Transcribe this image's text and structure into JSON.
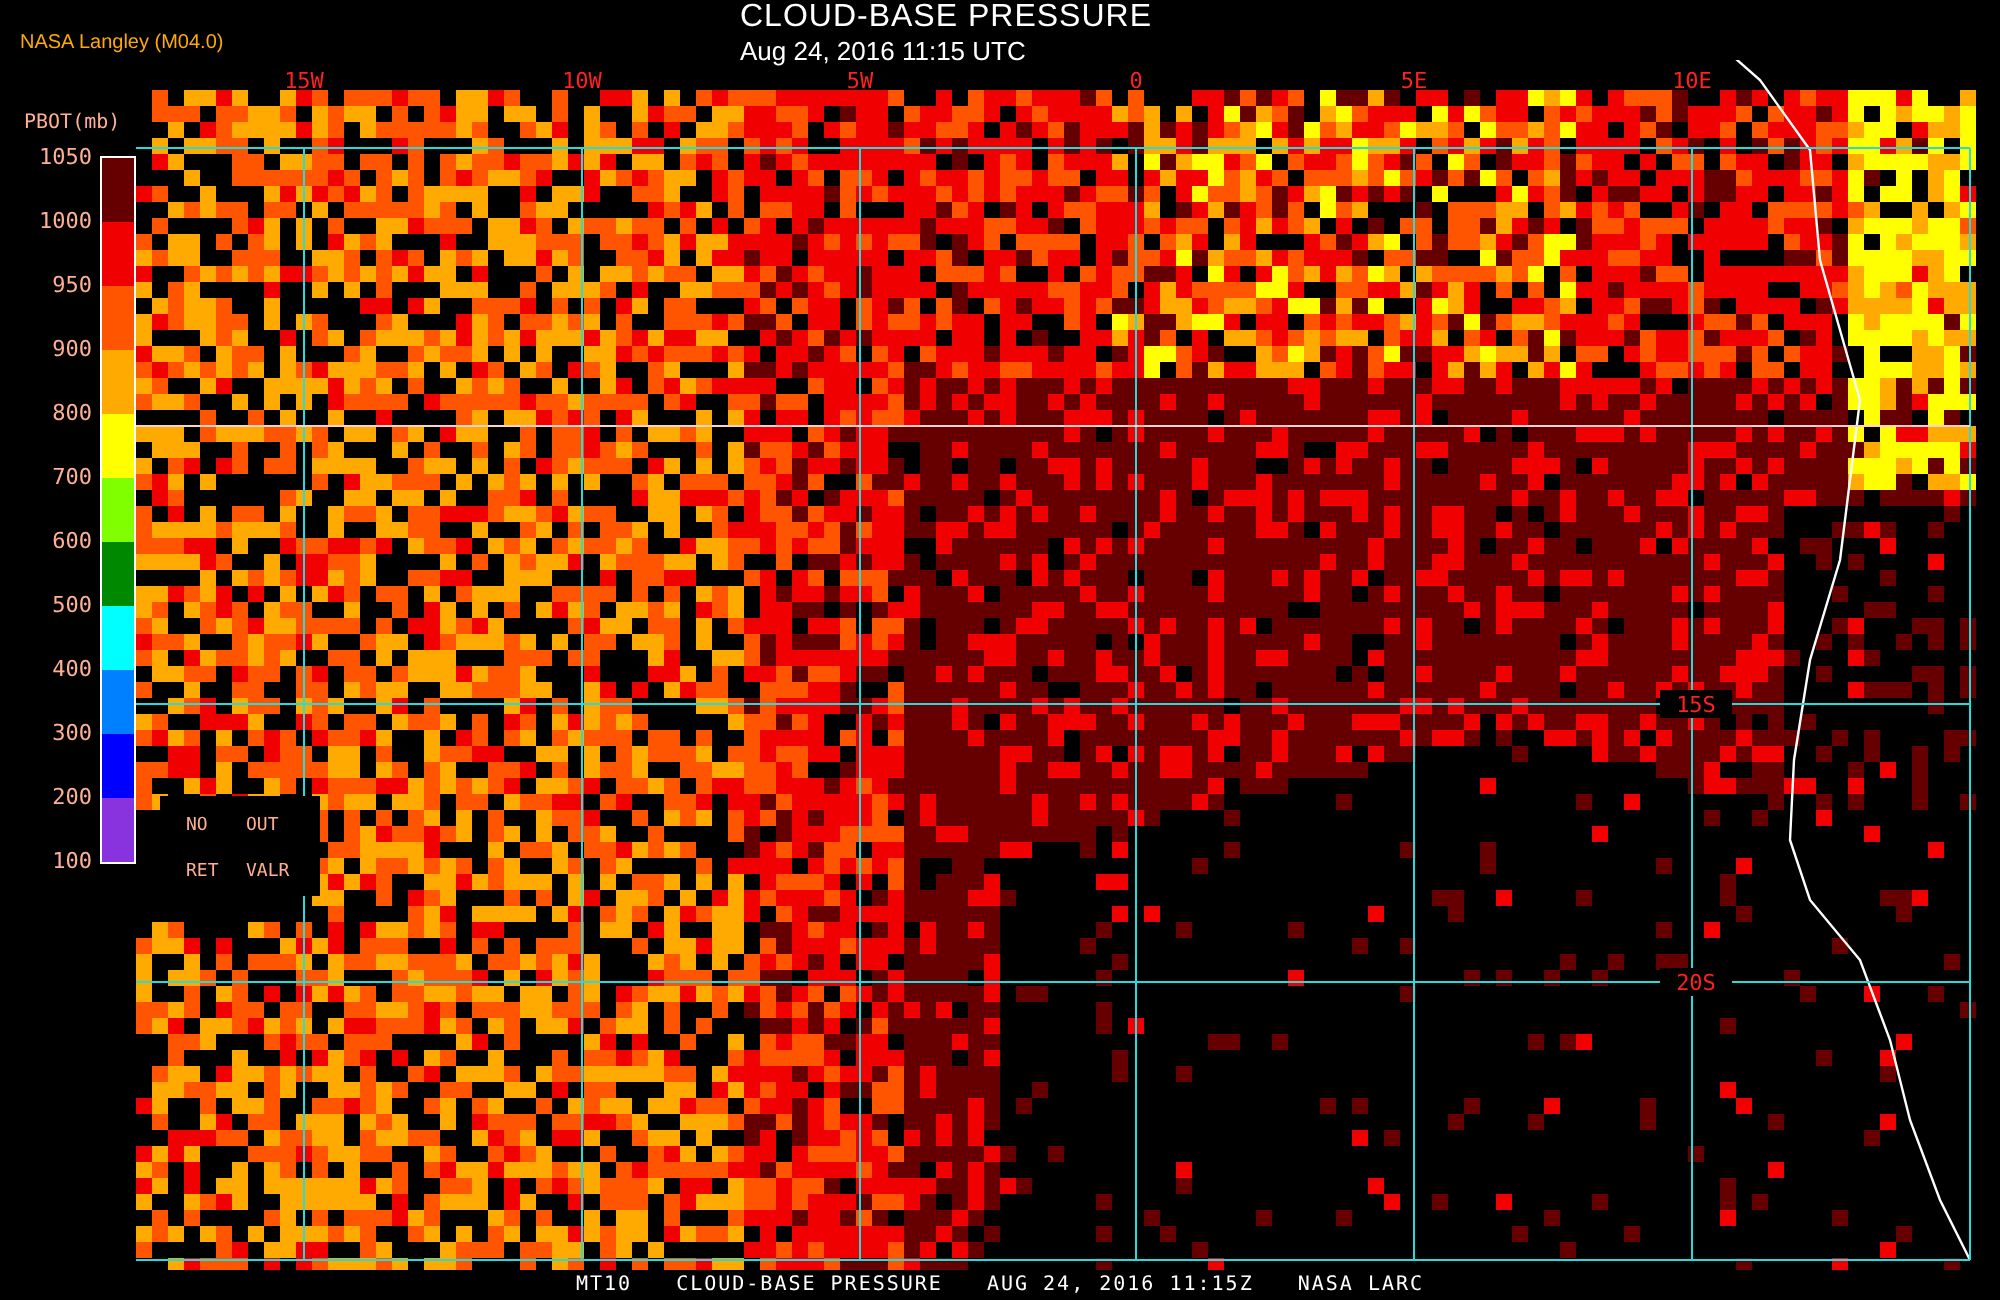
{
  "header": {
    "source": "NASA Langley (M04.0)",
    "title": "CLOUD-BASE PRESSURE",
    "subtitle": "Aug 24, 2016 11:15 UTC"
  },
  "legend": {
    "title": "PBOT(mb)",
    "labels": [
      "1050",
      "1000",
      "950",
      "900",
      "800",
      "700",
      "600",
      "500",
      "400",
      "300",
      "200",
      "100"
    ],
    "bands": [
      {
        "color": "#660000"
      },
      {
        "color": "#f00000"
      },
      {
        "color": "#ff5500"
      },
      {
        "color": "#ffaa00"
      },
      {
        "color": "#ffff00"
      },
      {
        "color": "#80ff00"
      },
      {
        "color": "#008800"
      },
      {
        "color": "#00ffff"
      },
      {
        "color": "#0080ff"
      },
      {
        "color": "#0000ff"
      },
      {
        "color": "#8833dd"
      }
    ],
    "notes": [
      "NO",
      "OUT",
      "RET",
      "VALR"
    ]
  },
  "map": {
    "lon_labels": [
      "15W",
      "10W",
      "5W",
      "0",
      "5E",
      "10E"
    ],
    "lat_labels": [
      "15S",
      "20S"
    ]
  },
  "footer": [
    "MT10",
    "CLOUD-BASE PRESSURE",
    "AUG 24, 2016 11:15Z",
    "NASA LARC"
  ]
}
